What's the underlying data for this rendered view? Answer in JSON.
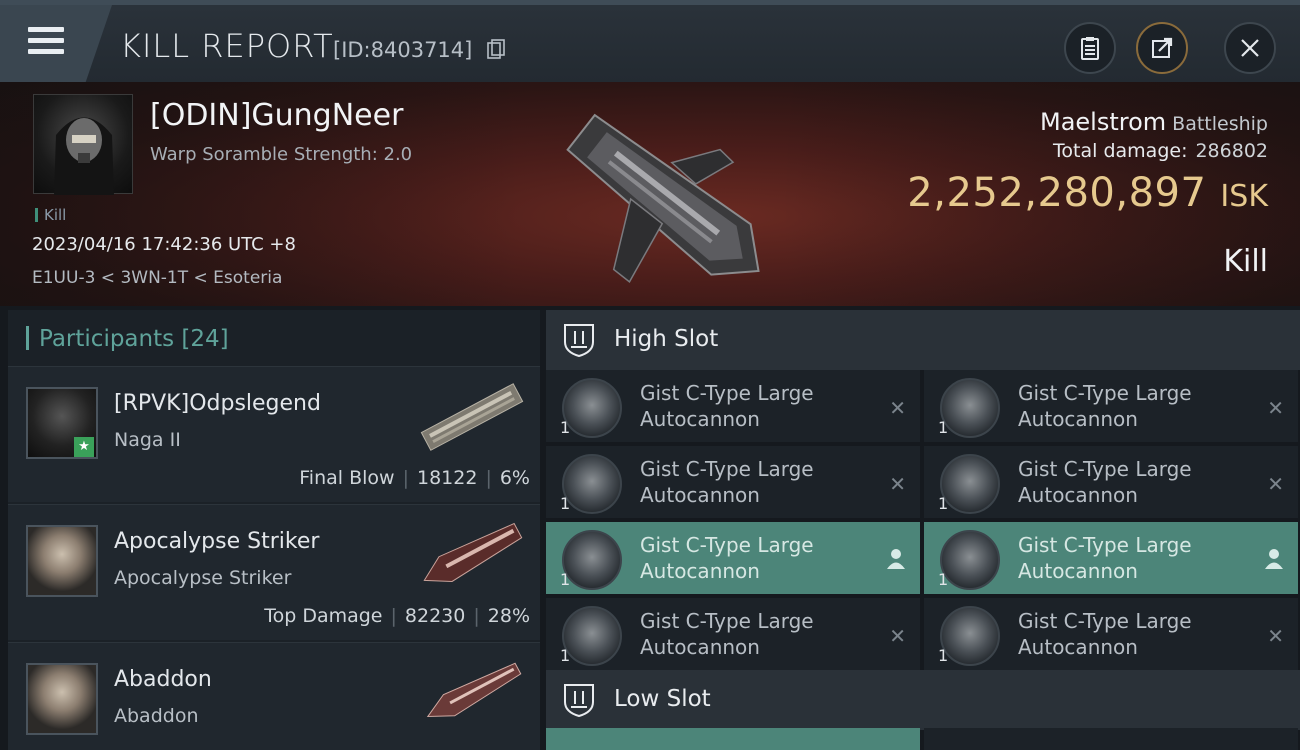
{
  "header": {
    "title": "KILL REPORT",
    "report_id": "[ID:8403714]"
  },
  "victim": {
    "name": "[ODIN]GungNeer",
    "scramble": "Warp Soramble Strength: 2.0",
    "tag": "Kill",
    "datetime": "2023/04/16 17:42:36 UTC +8",
    "location": "E1UU-3 < 3WN-1T < Esoteria",
    "ship_name": "Maelstrom",
    "ship_class": "Battleship",
    "total_damage_label": "Total damage:",
    "total_damage": "286802",
    "isk_value": "2,252,280,897",
    "isk_unit": "ISK",
    "result": "Kill"
  },
  "participants": {
    "label": "Participants [24]",
    "rows": [
      {
        "name": "[RPVK]Odpslegend",
        "ship": "Naga II",
        "role": "Final Blow",
        "damage": "18122",
        "percent": "6%"
      },
      {
        "name": "Apocalypse Striker",
        "ship": "Apocalypse Striker",
        "role": "Top Damage",
        "damage": "82230",
        "percent": "28%"
      },
      {
        "name": "Abaddon",
        "ship": "Abaddon"
      }
    ]
  },
  "slots": {
    "high_label": "High Slot",
    "low_label": "Low Slot",
    "modules": [
      {
        "line1": "Gist C-Type Large",
        "line2": "Autocannon",
        "qty": "1",
        "state": "✕"
      },
      {
        "line1": "Gist C-Type Large",
        "line2": "Autocannon",
        "qty": "1",
        "state": "✕"
      },
      {
        "line1": "Gist C-Type Large",
        "line2": "Autocannon",
        "qty": "1",
        "state": "✕"
      },
      {
        "line1": "Gist C-Type Large",
        "line2": "Autocannon",
        "qty": "1",
        "state": "✕"
      },
      {
        "line1": "Gist C-Type Large",
        "line2": "Autocannon",
        "qty": "1",
        "state": "person-icon"
      },
      {
        "line1": "Gist C-Type Large",
        "line2": "Autocannon",
        "qty": "1",
        "state": "person-icon"
      },
      {
        "line1": "Gist C-Type Large",
        "line2": "Autocannon",
        "qty": "1",
        "state": "✕"
      },
      {
        "line1": "Gist C-Type Large",
        "line2": "Autocannon",
        "qty": "1",
        "state": "✕"
      }
    ]
  },
  "colors": {
    "accent_teal": "#5fa39a",
    "active_row": "#4c8579",
    "isk_gold": "#e6c98e",
    "hero_red": "#4a1d1a"
  }
}
